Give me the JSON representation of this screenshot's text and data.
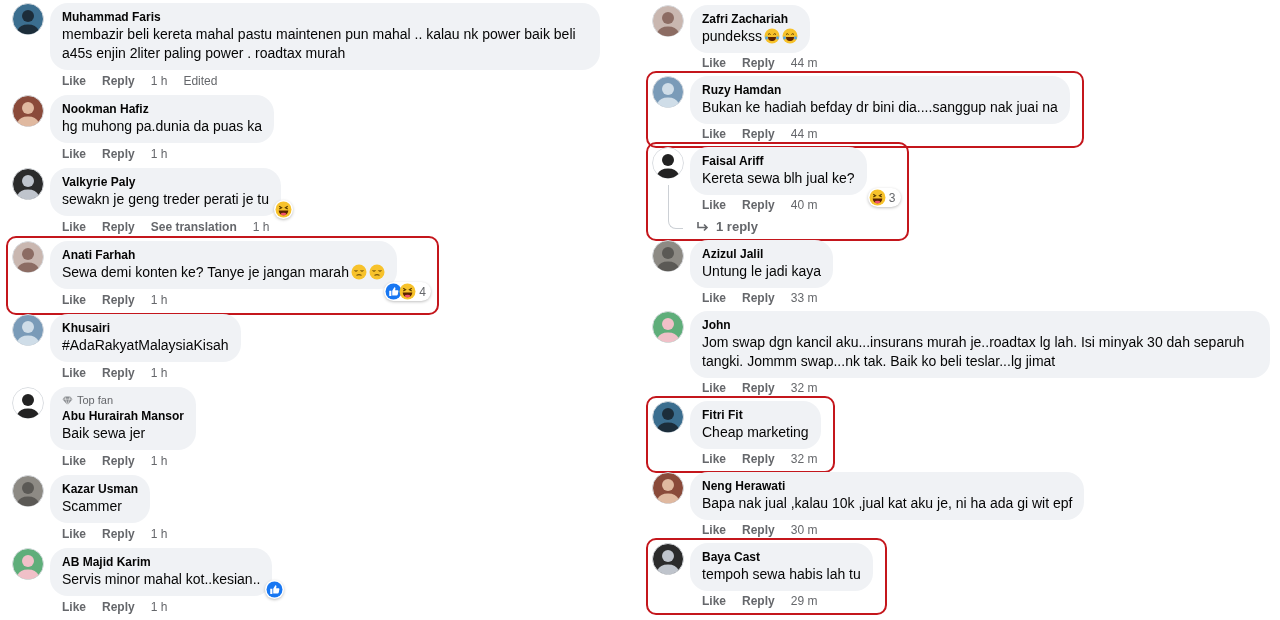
{
  "columns": [
    {
      "comments": [
        {
          "author": "Muhammad Faris",
          "text": "membazir beli kereta mahal pastu maintenen pun mahal .. kalau nk power baik beli a45s enjin 2liter paling power . roadtax murah",
          "highlighted": false,
          "actions": [
            {
              "kind": "link",
              "label": "Like"
            },
            {
              "kind": "link",
              "label": "Reply"
            },
            {
              "kind": "time",
              "label": "1 h"
            },
            {
              "kind": "note",
              "label": "Edited"
            }
          ]
        },
        {
          "author": "Nookman Hafiz",
          "text": "hg muhong pa.dunia da puas ka",
          "highlighted": false,
          "actions": [
            {
              "kind": "link",
              "label": "Like"
            },
            {
              "kind": "link",
              "label": "Reply"
            },
            {
              "kind": "time",
              "label": "1 h"
            }
          ]
        },
        {
          "author": "Valkyrie Paly",
          "text": "sewakn je geng treder perati je tu",
          "highlighted": false,
          "reactions": [
            {
              "kind": "haha"
            }
          ],
          "actions": [
            {
              "kind": "link",
              "label": "Like"
            },
            {
              "kind": "link",
              "label": "Reply"
            },
            {
              "kind": "link",
              "label": "See translation"
            },
            {
              "kind": "time",
              "label": "1 h"
            }
          ]
        },
        {
          "author": "Anati Farhah",
          "text": "Sewa demi konten ke? Tanye je jangan marah",
          "emojis": [
            {
              "kind": "pensive"
            },
            {
              "kind": "pensive"
            }
          ],
          "highlighted": true,
          "reactions": [
            {
              "kind": "like"
            },
            {
              "kind": "haha"
            }
          ],
          "reaction_count": "4",
          "actions": [
            {
              "kind": "link",
              "label": "Like"
            },
            {
              "kind": "link",
              "label": "Reply"
            },
            {
              "kind": "time",
              "label": "1 h"
            }
          ]
        },
        {
          "author": "Khusairi",
          "text": "#AdaRakyatMalaysiaKisah",
          "highlighted": false,
          "actions": [
            {
              "kind": "link",
              "label": "Like"
            },
            {
              "kind": "link",
              "label": "Reply"
            },
            {
              "kind": "time",
              "label": "1 h"
            }
          ]
        },
        {
          "author": "Abu Hurairah Mansor",
          "badge": "Top fan",
          "text": "Baik sewa jer",
          "highlighted": false,
          "actions": [
            {
              "kind": "link",
              "label": "Like"
            },
            {
              "kind": "link",
              "label": "Reply"
            },
            {
              "kind": "time",
              "label": "1 h"
            }
          ]
        },
        {
          "author": "Kazar Usman",
          "text": "Scammer",
          "highlighted": false,
          "actions": [
            {
              "kind": "link",
              "label": "Like"
            },
            {
              "kind": "link",
              "label": "Reply"
            },
            {
              "kind": "time",
              "label": "1 h"
            }
          ]
        },
        {
          "author": "AB Majid Karim",
          "text": "Servis minor mahal kot..kesian..",
          "highlighted": false,
          "reactions": [
            {
              "kind": "like"
            }
          ],
          "actions": [
            {
              "kind": "link",
              "label": "Like"
            },
            {
              "kind": "link",
              "label": "Reply"
            },
            {
              "kind": "time",
              "label": "1 h"
            }
          ]
        }
      ]
    },
    {
      "comments": [
        {
          "author": "Zafri Zachariah",
          "text": "pundekss",
          "emojis": [
            {
              "kind": "tears-of-joy"
            },
            {
              "kind": "tears-of-joy"
            }
          ],
          "highlighted": false,
          "actions": [
            {
              "kind": "link",
              "label": "Like"
            },
            {
              "kind": "link",
              "label": "Reply"
            },
            {
              "kind": "time",
              "label": "44 m"
            }
          ]
        },
        {
          "author": "Ruzy Hamdan",
          "text": "Bukan ke hadiah befday dr bini dia....sanggup nak juai na",
          "highlighted": true,
          "actions": [
            {
              "kind": "link",
              "label": "Like"
            },
            {
              "kind": "link",
              "label": "Reply"
            },
            {
              "kind": "time",
              "label": "44 m"
            }
          ]
        },
        {
          "author": "Faisal Ariff",
          "text": "Kereta sewa blh jual ke?",
          "highlighted": true,
          "reactions": [
            {
              "kind": "haha"
            }
          ],
          "reaction_count": "3",
          "replies": "1 reply",
          "actions": [
            {
              "kind": "link",
              "label": "Like"
            },
            {
              "kind": "link",
              "label": "Reply"
            },
            {
              "kind": "time",
              "label": "40 m"
            }
          ]
        },
        {
          "author": "Azizul Jalil",
          "text": "Untung le jadi kaya",
          "highlighted": false,
          "actions": [
            {
              "kind": "link",
              "label": "Like"
            },
            {
              "kind": "link",
              "label": "Reply"
            },
            {
              "kind": "time",
              "label": "33 m"
            }
          ]
        },
        {
          "author": "John",
          "text": "Jom swap dgn kancil aku...insurans murah je..roadtax lg lah. Isi minyak 30 dah separuh tangki. Jommm swap...nk tak. Baik ko beli teslar...lg jimat",
          "highlighted": false,
          "actions": [
            {
              "kind": "link",
              "label": "Like"
            },
            {
              "kind": "link",
              "label": "Reply"
            },
            {
              "kind": "time",
              "label": "32 m"
            }
          ]
        },
        {
          "author": "Fitri Fit",
          "text": "Cheap marketing",
          "highlighted": true,
          "actions": [
            {
              "kind": "link",
              "label": "Like"
            },
            {
              "kind": "link",
              "label": "Reply"
            },
            {
              "kind": "time",
              "label": "32 m"
            }
          ]
        },
        {
          "author": "Neng Herawati",
          "text": "Bapa nak jual ,kalau 10k ,jual kat aku je, ni ha ada gi wit epf",
          "highlighted": false,
          "actions": [
            {
              "kind": "link",
              "label": "Like"
            },
            {
              "kind": "link",
              "label": "Reply"
            },
            {
              "kind": "time",
              "label": "30 m"
            }
          ]
        },
        {
          "author": "Baya Cast",
          "text": "tempoh sewa habis lah tu",
          "highlighted": true,
          "actions": [
            {
              "kind": "link",
              "label": "Like"
            },
            {
              "kind": "link",
              "label": "Reply"
            },
            {
              "kind": "time",
              "label": "29 m"
            }
          ]
        }
      ]
    }
  ]
}
